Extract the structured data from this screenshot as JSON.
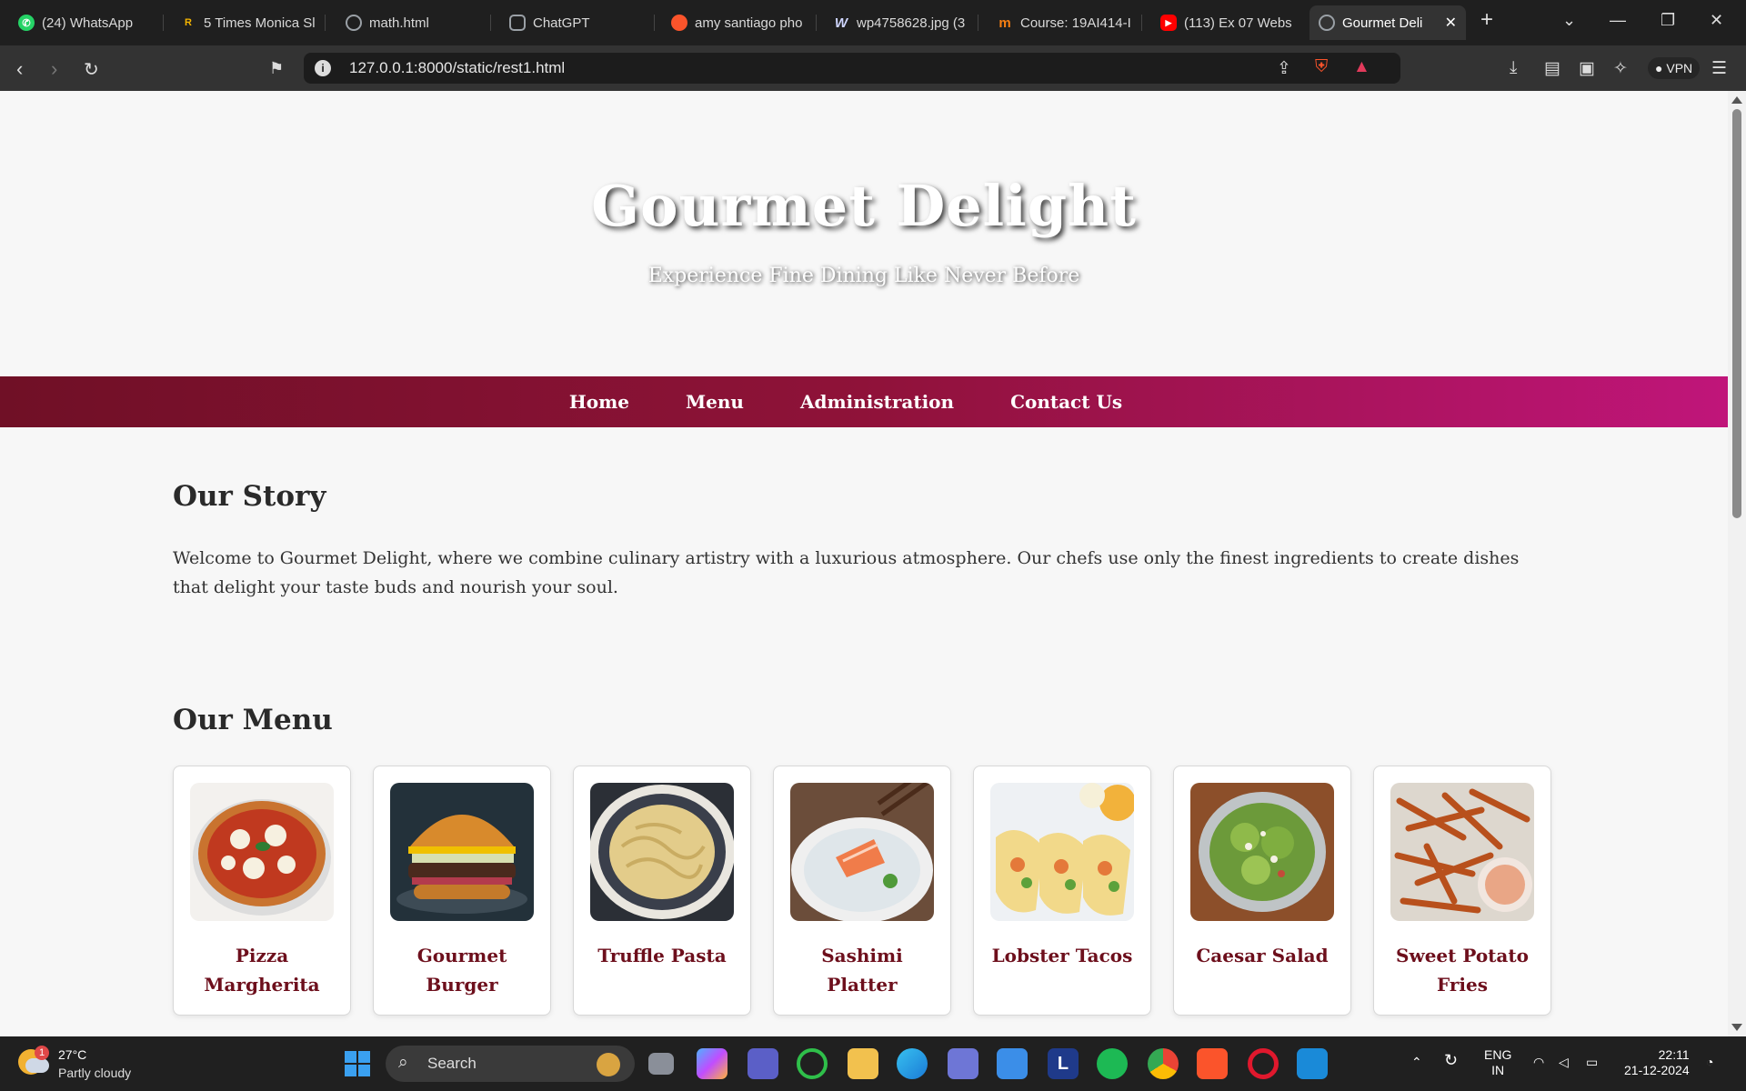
{
  "browser": {
    "tabs": [
      {
        "title": "(24) WhatsApp",
        "icon": "whatsapp-icon",
        "color": "#25d366"
      },
      {
        "title": "5 Times Monica Sl",
        "icon": "sr-icon",
        "color": "#f4b400"
      },
      {
        "title": "math.html",
        "icon": "globe-icon",
        "color": "#9aa0a6"
      },
      {
        "title": "ChatGPT",
        "icon": "openai-icon",
        "color": "#9aa0a6"
      },
      {
        "title": "amy santiago pho",
        "icon": "brave-shield-icon",
        "color": "#fb542b"
      },
      {
        "title": "wp4758628.jpg (3",
        "icon": "w-icon",
        "color": "#cfd6ff"
      },
      {
        "title": "Course: 19AI414-I",
        "icon": "moodle-icon",
        "color": "#f98012"
      },
      {
        "title": "(113) Ex 07 Webs",
        "icon": "youtube-icon",
        "color": "#ff0000"
      },
      {
        "title": "Gourmet Deli",
        "icon": "globe-icon",
        "color": "#9aa0a6"
      }
    ],
    "url": "127.0.0.1:8000/static/rest1.html",
    "vpn_label": "VPN"
  },
  "site": {
    "title": "Gourmet Delight",
    "tagline": "Experience Fine Dining Like Never Before",
    "nav": [
      "Home",
      "Menu",
      "Administration",
      "Contact Us"
    ],
    "story": {
      "heading": "Our Story",
      "text": "Welcome to Gourmet Delight, where we combine culinary artistry with a luxurious atmosphere. Our chefs use only the finest ingredients to create dishes that delight your taste buds and nourish your soul."
    },
    "menu": {
      "heading": "Our Menu",
      "items": [
        "Pizza Margherita",
        "Gourmet Burger",
        "Truffle Pasta",
        "Sashimi Platter",
        "Lobster Tacos",
        "Caesar Salad",
        "Sweet Potato Fries"
      ]
    },
    "accent_color": "#8f1239"
  },
  "taskbar": {
    "weather_temp": "27°C",
    "weather_cond": "Partly cloudy",
    "weather_badge": "1",
    "search_label": "Search",
    "lang": "ENG",
    "region": "IN",
    "time": "22:11",
    "date": "21-12-2024"
  }
}
